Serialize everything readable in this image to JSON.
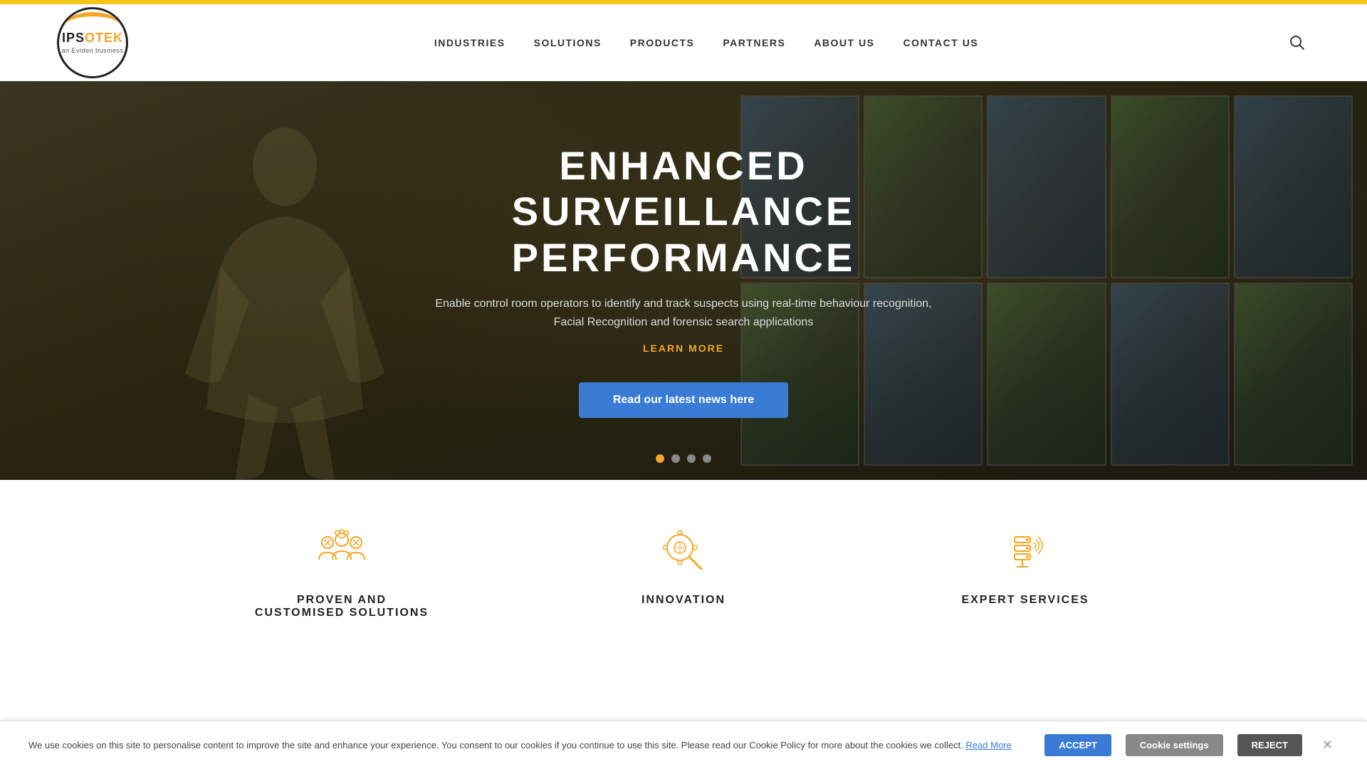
{
  "topbar": {},
  "header": {
    "logo": {
      "text_ips": "IPS",
      "text_otek": "OTEK",
      "subtitle": "an Eviden business"
    },
    "nav": {
      "items": [
        {
          "label": "INDUSTRIES",
          "id": "industries"
        },
        {
          "label": "SOLUTIONS",
          "id": "solutions"
        },
        {
          "label": "PRODUCTS",
          "id": "products"
        },
        {
          "label": "PARTNERS",
          "id": "partners"
        },
        {
          "label": "ABOUT US",
          "id": "about"
        },
        {
          "label": "CONTACT US",
          "id": "contact"
        }
      ]
    },
    "search_aria": "Search"
  },
  "hero": {
    "title_line1": "ENHANCED SURVEILLANCE",
    "title_line2": "PERFORMANCE",
    "subtitle": "Enable control room operators to identify and track suspects using real-time behaviour recognition, Facial Recognition and forensic search applications",
    "learn_more": "LEARN MORE",
    "news_button": "Read our latest news here",
    "dots": [
      {
        "active": true
      },
      {
        "active": false
      },
      {
        "active": false
      },
      {
        "active": false
      }
    ]
  },
  "features": {
    "items": [
      {
        "id": "proven",
        "title_line1": "PROVEN AND",
        "title_line2": "CUSTOMISED SOLUTIONS",
        "icon": "group-icon"
      },
      {
        "id": "innovation",
        "title_line1": "INNOVATION",
        "title_line2": "",
        "icon": "innovation-icon"
      },
      {
        "id": "expert",
        "title_line1": "EXPERT SERVICES",
        "title_line2": "",
        "icon": "expert-icon"
      }
    ]
  },
  "cookie": {
    "text": "We use cookies on this site to personalise content to improve the site and enhance your experience. You consent to our cookies if you continue to use this site. Please read our Cookie Policy for more about the cookies we collect.",
    "read_more": "Read More",
    "accept_label": "ACCEPT",
    "settings_label": "Cookie settings",
    "reject_label": "REJECT"
  }
}
